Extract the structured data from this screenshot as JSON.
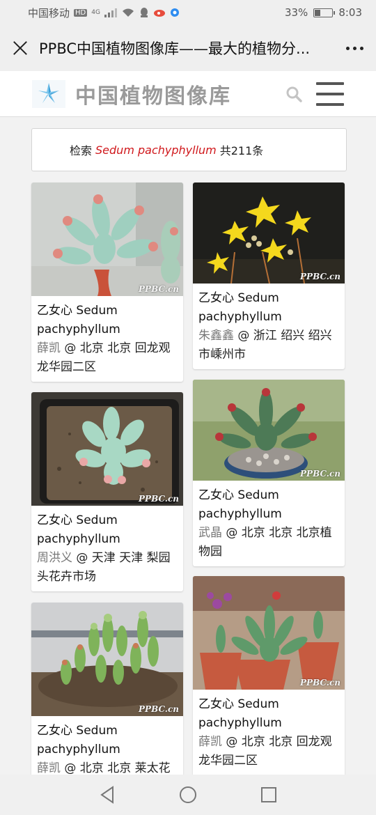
{
  "status_bar": {
    "carrier": "中国移动",
    "hd": "HD",
    "network": "4G",
    "battery_text": "33%",
    "battery_level": 0.33,
    "time": "8:03"
  },
  "app_bar": {
    "title": "PPBC中国植物图像库——最大的植物分..."
  },
  "site_header": {
    "logo_text": "中国植物图像库"
  },
  "search_result": {
    "prefix": "检索",
    "term": "Sedum pachyphyllum",
    "suffix": "共211条"
  },
  "watermark": "PPBC.cn",
  "cards": [
    {
      "name": "乙女心 Sedum pachyphyllum",
      "author": "薛凯",
      "location": " @ 北京 北京 回龙观龙华园二区"
    },
    {
      "name": "乙女心 Sedum pachyphyllum",
      "author": "朱鑫鑫",
      "location": " @ 浙江 绍兴 绍兴市嵊州市"
    },
    {
      "name": "乙女心 Sedum pachyphyllum",
      "author": "周洪义",
      "location": " @ 天津 天津 梨园头花卉市场"
    },
    {
      "name": "乙女心 Sedum pachyphyllum",
      "author": "武晶",
      "location": " @ 北京 北京 北京植物园"
    },
    {
      "name": "乙女心 Sedum pachyphyllum",
      "author": "薛凯",
      "location": " @ 北京 北京 莱太花"
    },
    {
      "name": "乙女心 Sedum pachyphyllum",
      "author": "薛凯",
      "location": " @ 北京 北京 回龙观龙华园二区"
    }
  ],
  "icons": {
    "close": "close-icon",
    "more": "more-icon",
    "search": "search-icon",
    "menu": "menu-icon",
    "back": "back-icon",
    "home": "home-icon",
    "recents": "recents-icon"
  }
}
